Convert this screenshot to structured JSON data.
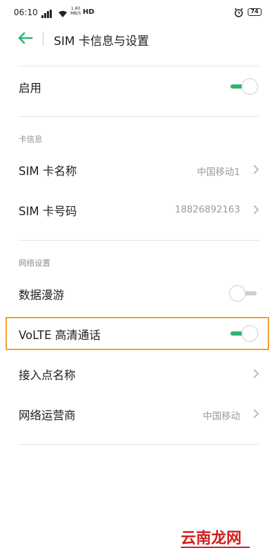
{
  "status_bar": {
    "time": "06:10",
    "speed_value": "1.60",
    "speed_unit": "MB/S",
    "network_type": "HD",
    "battery_level": "74"
  },
  "header": {
    "title": "SIM 卡信息与设置"
  },
  "settings": {
    "enable": {
      "label": "启用",
      "toggle_on": true
    },
    "card_info_section": "卡信息",
    "sim_name": {
      "label": "SIM 卡名称",
      "value": "中国移动1"
    },
    "sim_number": {
      "label": "SIM 卡号码",
      "value": "18826892163"
    },
    "network_section": "网络设置",
    "data_roaming": {
      "label": "数据漫游",
      "toggle_on": false
    },
    "volte": {
      "label": "VoLTE 高清通话",
      "toggle_on": true
    },
    "apn": {
      "label": "接入点名称"
    },
    "operator": {
      "label": "网络运营商",
      "value": "中国移动"
    }
  },
  "watermark": "云南龙网",
  "colors": {
    "toggle_on": "#2ab673",
    "highlight": "#f0a030",
    "back_arrow": "#2ab673",
    "watermark": "#d01d1d"
  }
}
